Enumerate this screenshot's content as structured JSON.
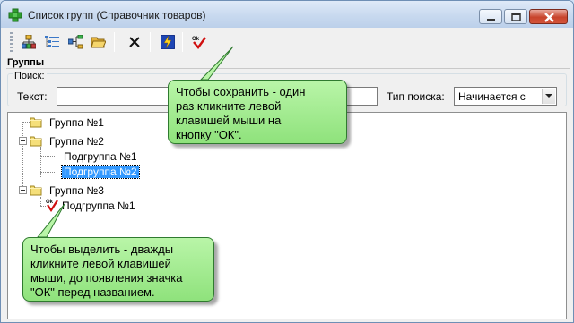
{
  "window": {
    "title": "Список групп (Справочник товаров)"
  },
  "toolbar": {
    "tools": [
      {
        "icon": "org-chart-icon"
      },
      {
        "icon": "list-view-icon"
      },
      {
        "icon": "add-node-icon"
      },
      {
        "icon": "open-folder-icon"
      },
      {
        "icon": "delete-icon"
      },
      {
        "icon": "lightning-icon"
      },
      {
        "icon": "ok-checkmark-icon"
      }
    ]
  },
  "groups": {
    "label": "Группы"
  },
  "search": {
    "legend": "Поиск:",
    "text_label": "Текст:",
    "text_value": "",
    "type_label": "Тип поиска:",
    "type_value": "Начинается с"
  },
  "tree": {
    "nodes": [
      {
        "label": "Группа №1"
      },
      {
        "label": "Группа №2"
      },
      {
        "label": "Подгруппа №1"
      },
      {
        "label": "Подгруппа №2",
        "selected": true
      },
      {
        "label": "Группа №3"
      },
      {
        "label": "Подгруппа №1",
        "ok_mark": true
      }
    ]
  },
  "callouts": {
    "save": [
      "Чтобы сохранить - один",
      "раз кликните левой",
      "клавишей мыши на",
      "кнопку \"ОК\"."
    ],
    "select": [
      "Чтобы выделить - дважды",
      "кликните левой клавишей",
      "мыши, до появления значка",
      "\"ОК\" перед названием."
    ]
  },
  "colors": {
    "callout_fill": "#a6ec92",
    "selection": "#3399ff",
    "title_bar": "#c8d9ef",
    "close_button": "#c8442c"
  }
}
